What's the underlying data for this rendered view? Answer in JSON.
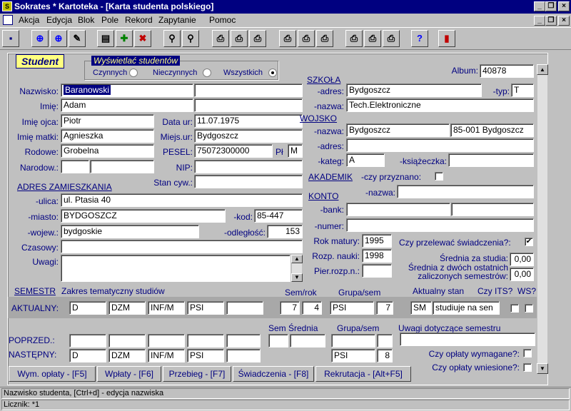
{
  "app": {
    "title": "Sokrates * Kartoteka - [Karta studenta polskiego]"
  },
  "menu": [
    "Akcja",
    "Edycja",
    "Blok",
    "Pole",
    "Rekord",
    "Zapytanie",
    "Pomoc"
  ],
  "student_tab": "Student",
  "filter": {
    "title": "Wyświetlać studentów",
    "opt1": "Czynnych",
    "opt2": "Nieczynnych",
    "opt3": "Wszystkich",
    "selected": "Wszystkich"
  },
  "album": {
    "label": "Album:",
    "value": "40878"
  },
  "personal": {
    "nazwisko_label": "Nazwisko:",
    "nazwisko": "Baranowski",
    "imie_label": "Imię:",
    "imie": "Adam",
    "imie_ojca_label": "Imię ojca:",
    "imie_ojca": "Piotr",
    "data_ur_label": "Data ur:",
    "data_ur": "11.07.1975",
    "imie_matki_label": "Imię matki:",
    "imie_matki": "Agnieszka",
    "miejs_ur_label": "Miejs.ur:",
    "miejs_ur": "Bydgoszcz",
    "rodowe_label": "Rodowe:",
    "rodowe": "Grobelna",
    "pesel_label": "PESEL:",
    "pesel": "75072300000",
    "plec_label": "Pł",
    "plec": "M",
    "narodow_label": "Narodow.:",
    "nip_label": "NIP:",
    "stan_label": "Stan cyw.:"
  },
  "address": {
    "title": "ADRES ZAMIESZKANIA",
    "ulica_label": "-ulica:",
    "ulica": "ul. Ptasia 40",
    "miasto_label": "-miasto:",
    "miasto": "BYDGOSZCZ",
    "kod_label": "-kod:",
    "kod": "85-447",
    "wojew_label": "-wojew.:",
    "wojew": "bydgoskie",
    "odl_label": "-odległość:",
    "odl": "153",
    "czasowy_label": "Czasowy:",
    "uwagi_label": "Uwagi:"
  },
  "szkola": {
    "title": "SZKOŁA",
    "adres_label": "-adres:",
    "adres": "Bydgoszcz",
    "typ_label": "-typ:",
    "typ": "T",
    "nazwa_label": "-nazwa:",
    "nazwa": "Tech.Elektroniczne"
  },
  "wojsko": {
    "title": "WOJSKO",
    "nazwa_label": "-nazwa:",
    "nazwa": "Bydgoszcz",
    "nazwa2": "85-001 Bydgoszcz",
    "adres_label": "-adres:",
    "kateg_label": "-kateg:",
    "kateg": "A",
    "ksiazeczka_label": "-książeczka:"
  },
  "akademik": {
    "title": "AKADEMIK",
    "przyznano_label": "-czy przyznano:",
    "nazwa_label": "-nazwa:"
  },
  "konto": {
    "title": "KONTO",
    "bank_label": "-bank:",
    "numer_label": "-numer:"
  },
  "matura": {
    "rok_label": "Rok matury:",
    "rok": "1995",
    "rozp_label": "Rozp. nauki:",
    "rozp": "1998",
    "pier_label": "Pier.rozp.n.:"
  },
  "swiadczenia": {
    "label": "Czy przelewać świadczenia?:",
    "checked": "✔",
    "srednia_label": "Średnia za studia:",
    "srednia": "0,00",
    "srednia2_label1": "Średnia z dwóch ostatnich",
    "srednia2_label2": "zaliczonych semestrów:",
    "srednia2": "0,00"
  },
  "semestr": {
    "title": "SEMESTR",
    "zakres_label": "Zakres tematyczny studiów",
    "semrok_label": "Sem/rok",
    "grupa_label": "Grupa/sem",
    "stan_label": "Aktualny stan",
    "its_label": "Czy ITS?",
    "ws_label": "WS?",
    "aktualny_label": "AKTUALNY:",
    "aktualny": [
      "D",
      "DZM",
      "INF/M",
      "PSI",
      ""
    ],
    "aktualny_sem": "7",
    "aktualny_rok": "4",
    "aktualny_grupa": "PSI",
    "aktualny_grupa_sem": "7",
    "aktualny_stan_kod": "SM",
    "aktualny_stan": "studiuje na sen",
    "poprzed_label": "POPRZED.:",
    "nastepny_label": "NASTĘPNY:",
    "nastepny": [
      "D",
      "DZM",
      "INF/M",
      "PSI",
      ""
    ],
    "sem_srednia_label": "Sem Średnia",
    "grupa2_label": "Grupa/sem",
    "nastepny_grupa": "PSI",
    "nastepny_grupa_sem": "8",
    "uwagi_label": "Uwagi dotyczące semestru",
    "oplaty_wym_label": "Czy opłaty wymagane?:",
    "oplaty_wn_label": "Czy opłaty wniesione?:"
  },
  "buttons": [
    "Wym. opłaty - [F5]",
    "Wpłaty - [F6]",
    "Przebieg - [F7]",
    "Świadczenia - [F8]",
    "Rekrutacja - [Alt+F5]"
  ],
  "status": {
    "line1": "Nazwisko studenta, [Ctrl+d] - edycja nazwiska",
    "line2": "Licznik: *1"
  }
}
